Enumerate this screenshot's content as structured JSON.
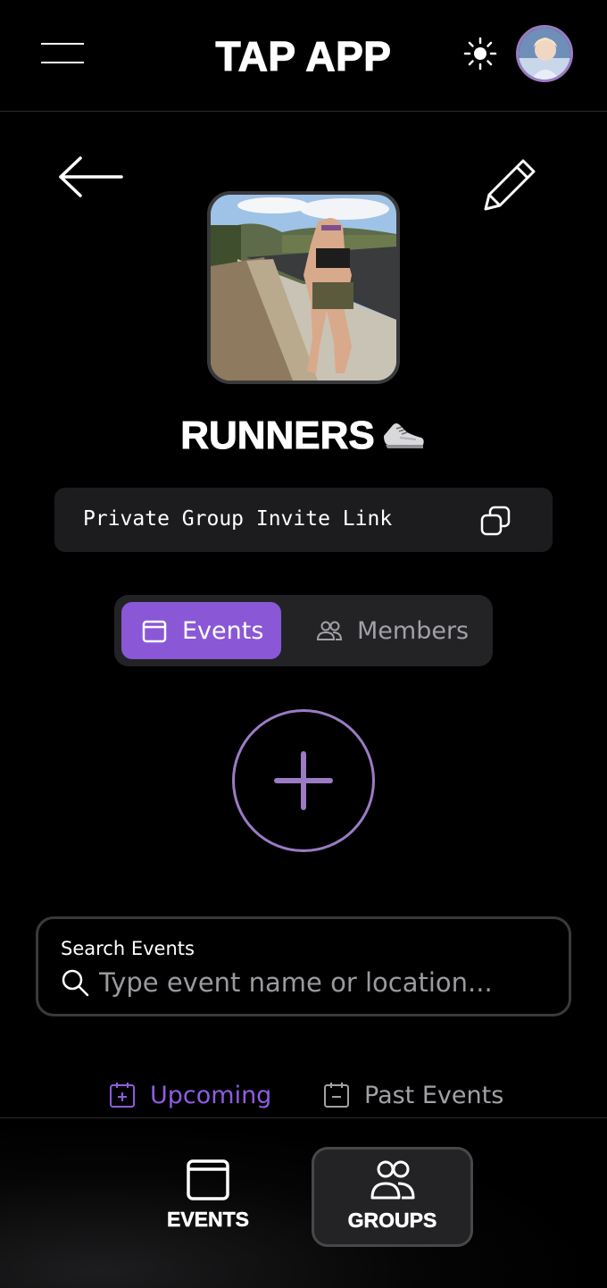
{
  "header": {
    "title": "TAP APP",
    "menu_icon": "hamburger-menu-icon",
    "theme_icon": "sun-icon",
    "avatar_alt": "User avatar"
  },
  "group": {
    "name": "RUNNERS",
    "name_emoji": "running-shoe-emoji",
    "photo_alt": "Woman running on a road"
  },
  "invite": {
    "label": "Private Group Invite Link",
    "icon": "copy-icon"
  },
  "segment": {
    "events_label": "Events",
    "members_label": "Members",
    "selected": "Events"
  },
  "search": {
    "label": "Search Events",
    "placeholder": "Type event name or location...",
    "value": ""
  },
  "subtabs": {
    "upcoming_label": "Upcoming",
    "past_label": "Past Events",
    "selected": "Upcoming"
  },
  "bottom_nav": {
    "events_label": "EVENTS",
    "groups_label": "GROUPS",
    "selected": "GROUPS"
  },
  "colors": {
    "accent": "#8a57d6",
    "accent_ring": "#9b7bc4",
    "background": "#000000",
    "surface": "#1c1c1e"
  }
}
